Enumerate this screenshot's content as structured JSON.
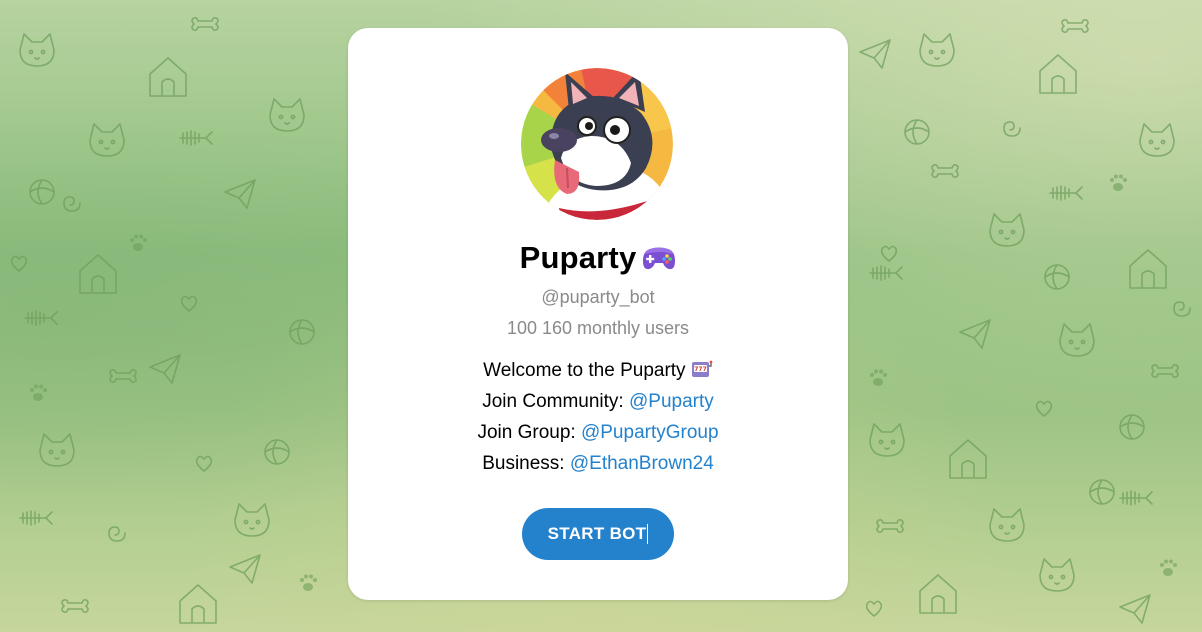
{
  "bot": {
    "name": "Puparty",
    "name_emoji": "gamepad-emoji",
    "username": "@puparty_bot",
    "monthly_users": "100 160 monthly users"
  },
  "description": {
    "welcome_text": "Welcome to the Puparty",
    "welcome_emoji": "slot-machine-emoji",
    "community_label": "Join Community:",
    "community_link": "@Puparty",
    "group_label": "Join Group:",
    "group_link": "@PupartyGroup",
    "business_label": "Business:",
    "business_link": "@EthanBrown24"
  },
  "actions": {
    "start_label": "START BOT"
  },
  "colors": {
    "accent": "#2481cc",
    "background": "#9cc485",
    "card": "#ffffff",
    "muted_text": "#8a8a8a"
  }
}
